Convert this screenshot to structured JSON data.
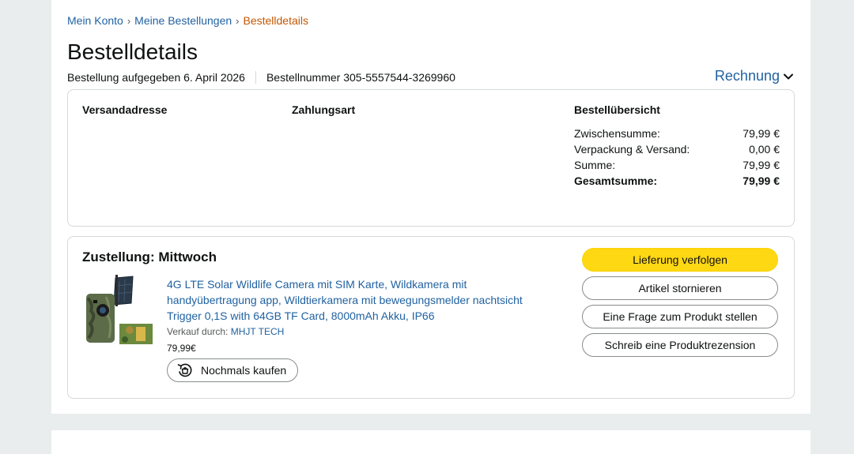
{
  "breadcrumb": {
    "account": "Mein Konto",
    "orders": "Meine Bestellungen",
    "current": "Bestelldetails",
    "separator": "›"
  },
  "page_title": "Bestelldetails",
  "order_meta": {
    "placed": "Bestellung aufgegeben 6. April 2026",
    "order_number": "Bestellnummer 305-5557544-3269960"
  },
  "invoice": {
    "label": "Rechnung",
    "icon": "chevron-down-icon"
  },
  "summary": {
    "shipping_address_label": "Versandadresse",
    "payment_label": "Zahlungsart",
    "overview_label": "Bestellübersicht",
    "rows": [
      {
        "label": "Zwischensumme:",
        "value": "79,99 €"
      },
      {
        "label": "Verpackung & Versand:",
        "value": "0,00 €"
      },
      {
        "label": "Summe:",
        "value": "79,99 €"
      }
    ],
    "total": {
      "label": "Gesamtsumme:",
      "value": "79,99 €"
    }
  },
  "delivery": {
    "title": "Zustellung: Mittwoch",
    "product": {
      "title": "4G LTE Solar Wildlife Camera mit SIM Karte, Wildkamera mit handyübertragung app, Wildtierkamera mit bewegungsmelder nachtsicht Trigger 0,1S with 64GB TF Card, 8000mAh Akku, IP66",
      "seller_prefix": "Verkauf durch:",
      "seller": "MHJT TECH",
      "price": "79,99€",
      "buy_again": "Nochmals kaufen"
    },
    "actions": {
      "track": "Lieferung verfolgen",
      "cancel": "Artikel stornieren",
      "question": "Eine Frage zum Produkt stellen",
      "review": "Schreib eine Produktrezension"
    }
  },
  "colors": {
    "link": "#2162a1",
    "breadcrumb_current": "#c45500",
    "primary_button": "#ffd814",
    "page_background": "#eaeded"
  }
}
